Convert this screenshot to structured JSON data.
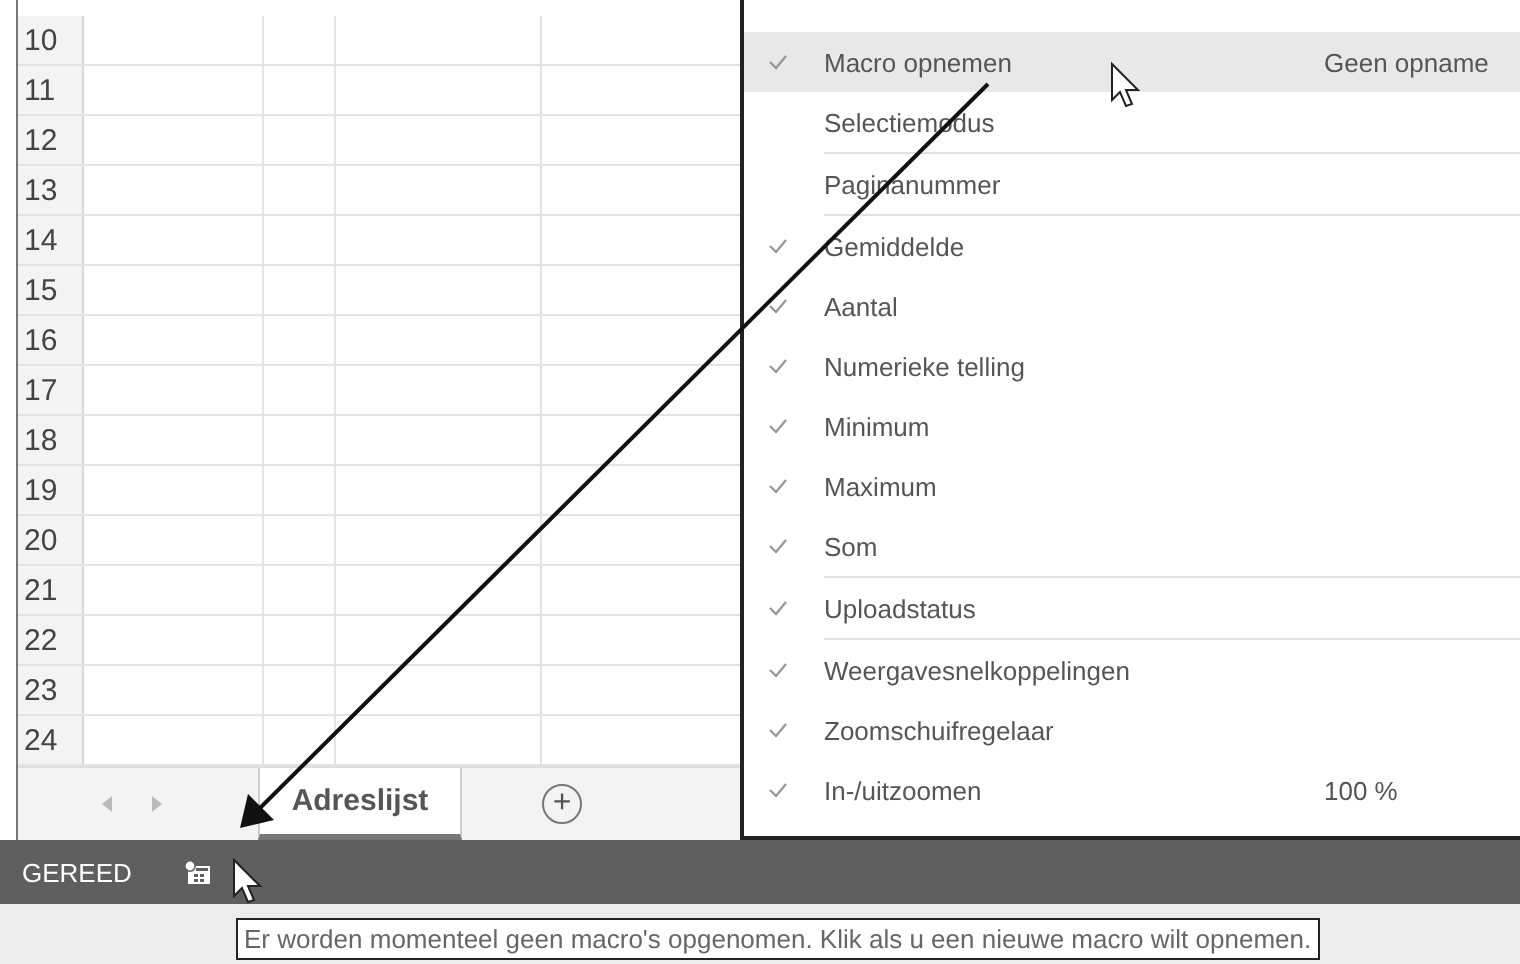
{
  "sheet": {
    "row_numbers": [
      "10",
      "11",
      "12",
      "13",
      "14",
      "15",
      "16",
      "17",
      "18",
      "19",
      "20",
      "21",
      "22",
      "23",
      "24"
    ],
    "tabs": [
      {
        "label": "Adreslijst",
        "selected": true
      }
    ],
    "add_sheet": "+"
  },
  "context_menu": {
    "items": [
      {
        "label": "Macro opnemen",
        "value": "Geen opname",
        "checked": true,
        "highlighted": true,
        "separator_after": false
      },
      {
        "label": "Selectiemodus",
        "checked": false,
        "highlighted": false,
        "separator_after": true
      },
      {
        "label": "Paginanummer",
        "checked": false,
        "highlighted": false,
        "separator_after": true
      },
      {
        "label": "Gemiddelde",
        "checked": true,
        "highlighted": false,
        "separator_after": false
      },
      {
        "label": "Aantal",
        "checked": true,
        "highlighted": false,
        "separator_after": false
      },
      {
        "label": "Numerieke telling",
        "checked": true,
        "highlighted": false,
        "separator_after": false
      },
      {
        "label": "Minimum",
        "checked": true,
        "highlighted": false,
        "separator_after": false
      },
      {
        "label": "Maximum",
        "checked": true,
        "highlighted": false,
        "separator_after": false
      },
      {
        "label": "Som",
        "checked": true,
        "highlighted": false,
        "separator_after": true
      },
      {
        "label": "Uploadstatus",
        "checked": true,
        "highlighted": false,
        "separator_after": true
      },
      {
        "label": "Weergavesnelkoppelingen",
        "checked": true,
        "highlighted": false,
        "separator_after": false
      },
      {
        "label": "Zoomschuifregelaar",
        "checked": true,
        "highlighted": false,
        "separator_after": false
      },
      {
        "label": "In-/uitzoomen",
        "value": "100 %",
        "checked": true,
        "highlighted": false,
        "separator_after": false
      }
    ]
  },
  "status_bar": {
    "status": "GEREED"
  },
  "tooltip": "Er worden momenteel geen macro's opgenomen. Klik als u een nieuwe macro wilt opnemen."
}
